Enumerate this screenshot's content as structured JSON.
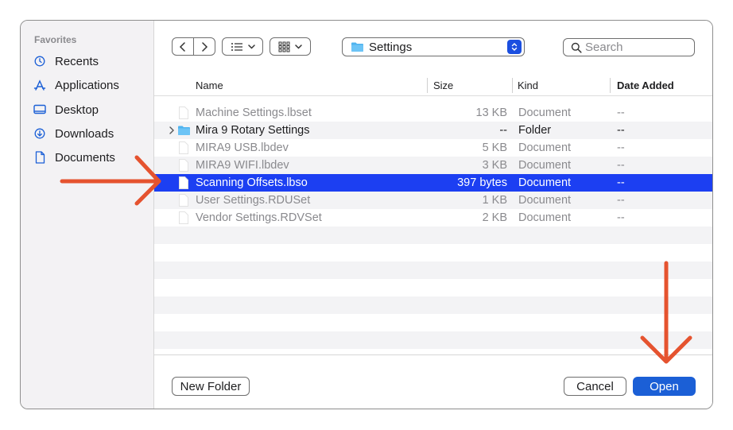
{
  "sidebar": {
    "heading": "Favorites",
    "items": [
      {
        "label": "Recents",
        "icon": "clock-icon"
      },
      {
        "label": "Applications",
        "icon": "applications-icon"
      },
      {
        "label": "Desktop",
        "icon": "desktop-icon"
      },
      {
        "label": "Downloads",
        "icon": "download-circle-icon"
      },
      {
        "label": "Documents",
        "icon": "document-icon"
      }
    ]
  },
  "toolbar": {
    "location": "Settings",
    "search_placeholder": "Search"
  },
  "columns": {
    "name": "Name",
    "size": "Size",
    "kind": "Kind",
    "date_added": "Date Added"
  },
  "files": [
    {
      "name": "Machine Settings.lbset",
      "size": "13 KB",
      "kind": "Document",
      "date_added": "--",
      "enabled": false,
      "is_folder": false,
      "selected": false
    },
    {
      "name": "Mira 9 Rotary Settings",
      "size": "--",
      "kind": "Folder",
      "date_added": "--",
      "enabled": true,
      "is_folder": true,
      "selected": false
    },
    {
      "name": "MIRA9 USB.lbdev",
      "size": "5 KB",
      "kind": "Document",
      "date_added": "--",
      "enabled": false,
      "is_folder": false,
      "selected": false
    },
    {
      "name": "MIRA9 WIFI.lbdev",
      "size": "3 KB",
      "kind": "Document",
      "date_added": "--",
      "enabled": false,
      "is_folder": false,
      "selected": false
    },
    {
      "name": "Scanning Offsets.lbso",
      "size": "397 bytes",
      "kind": "Document",
      "date_added": "--",
      "enabled": true,
      "is_folder": false,
      "selected": true
    },
    {
      "name": "User Settings.RDUSet",
      "size": "1 KB",
      "kind": "Document",
      "date_added": "--",
      "enabled": false,
      "is_folder": false,
      "selected": false
    },
    {
      "name": "Vendor Settings.RDVSet",
      "size": "2 KB",
      "kind": "Document",
      "date_added": "--",
      "enabled": false,
      "is_folder": false,
      "selected": false
    }
  ],
  "footer": {
    "new_folder": "New Folder",
    "cancel": "Cancel",
    "open": "Open"
  },
  "colors": {
    "selection": "#1c3ff2",
    "primary_button": "#1b5fd6",
    "annotation_arrow": "#e5532f"
  }
}
